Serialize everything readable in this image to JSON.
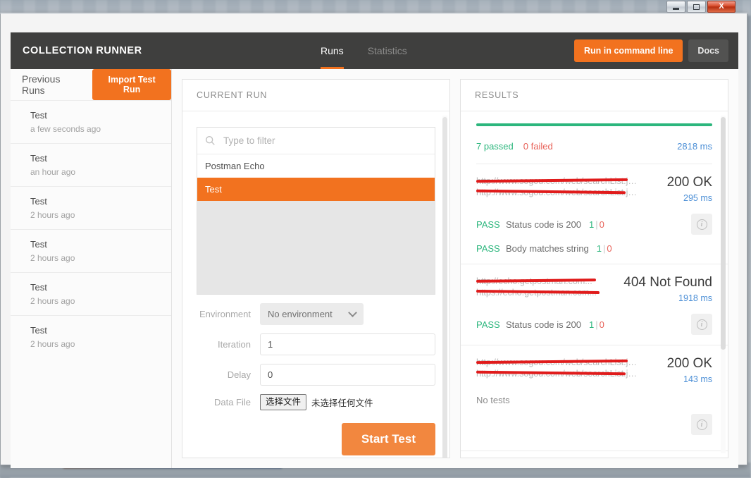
{
  "window": {
    "controls": {
      "minimize": "minimize",
      "maximize": "maximize",
      "close": "X"
    }
  },
  "app_bar": {
    "title": "COLLECTION RUNNER",
    "tabs": [
      {
        "label": "Runs",
        "active": true
      },
      {
        "label": "Statistics",
        "active": false
      }
    ],
    "run_cli_label": "Run in command line",
    "docs_label": "Docs"
  },
  "sidebar": {
    "heading": "Previous Runs",
    "import_label": "Import Test Run",
    "runs": [
      {
        "name": "Test",
        "time": "a few seconds ago"
      },
      {
        "name": "Test",
        "time": "an hour ago"
      },
      {
        "name": "Test",
        "time": "2 hours ago"
      },
      {
        "name": "Test",
        "time": "2 hours ago"
      },
      {
        "name": "Test",
        "time": "2 hours ago"
      },
      {
        "name": "Test",
        "time": "2 hours ago"
      }
    ]
  },
  "current_run": {
    "header": "CURRENT RUN",
    "filter_placeholder": "Type to filter",
    "collections": [
      {
        "label": "Postman Echo",
        "selected": false
      },
      {
        "label": "Test",
        "selected": true
      }
    ],
    "form": {
      "environment_label": "Environment",
      "environment_value": "No environment",
      "iteration_label": "Iteration",
      "iteration_value": "1",
      "delay_label": "Delay",
      "delay_value": "0",
      "data_file_label": "Data File",
      "file_button_label": "选择文件",
      "file_status": "未选择任何文件",
      "start_label": "Start Test"
    }
  },
  "results": {
    "header": "RESULTS",
    "progress_percent": 100,
    "passed": "7 passed",
    "failed": "0 failed",
    "total_time": "2818 ms",
    "blocks": [
      {
        "url_line1": "http://www.sogou.com/web/searchList.jsp...",
        "url_line2": "http://www.sogou.com/web/searchList.jsp?...",
        "status": "200 OK",
        "time": "295 ms",
        "assertions": [
          {
            "result": "PASS",
            "name": "Status code is 200",
            "pass": "1",
            "fail": "0"
          },
          {
            "result": "PASS",
            "name": "Body matches string",
            "pass": "1",
            "fail": "0"
          }
        ],
        "no_tests": null
      },
      {
        "url_line1": "http://echo.getpostman.com...",
        "url_line2": "https://echo.getpostman.com...",
        "status": "404 Not Found",
        "time": "1918 ms",
        "assertions": [
          {
            "result": "PASS",
            "name": "Status code is 200",
            "pass": "1",
            "fail": "0"
          }
        ],
        "no_tests": null
      },
      {
        "url_line1": "http://www.sogou.com/web/searchList.jsp...",
        "url_line2": "http://www.sogou.com/web/searchList.jsp?...",
        "status": "200 OK",
        "time": "143 ms",
        "assertions": [],
        "no_tests": "No tests"
      }
    ]
  },
  "colors": {
    "accent_orange": "#f2721f",
    "pass_green": "#2cb67d",
    "fail_red": "#e8635a",
    "time_blue": "#4c8fd6",
    "app_bar_dark": "#3f3f3e",
    "redaction_red": "#e01b1b"
  }
}
